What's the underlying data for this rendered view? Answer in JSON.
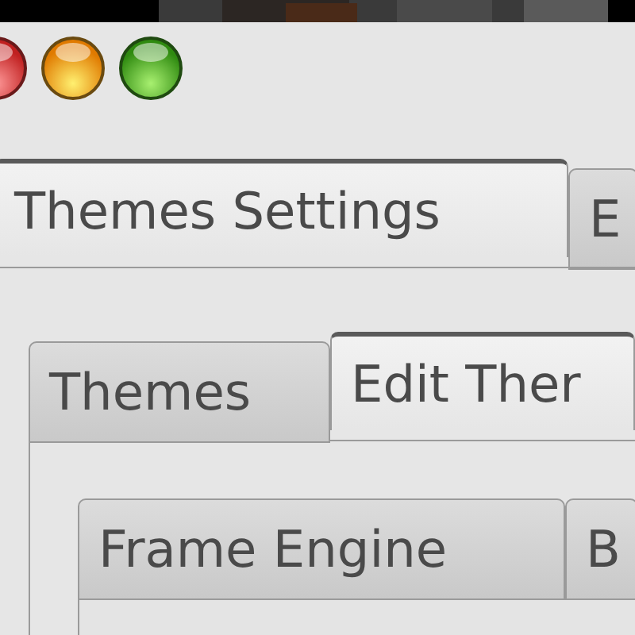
{
  "tabs": [
    {
      "label": "Themes Settings",
      "selected": true
    },
    {
      "label": "E",
      "selected": false
    }
  ],
  "inner_tabs": [
    {
      "label": "Themes",
      "selected": false
    },
    {
      "label": "Edit Ther",
      "selected": true
    }
  ],
  "sub_tabs": [
    {
      "label": "Frame Engine",
      "selected": false
    },
    {
      "label": "B",
      "selected": false
    }
  ]
}
